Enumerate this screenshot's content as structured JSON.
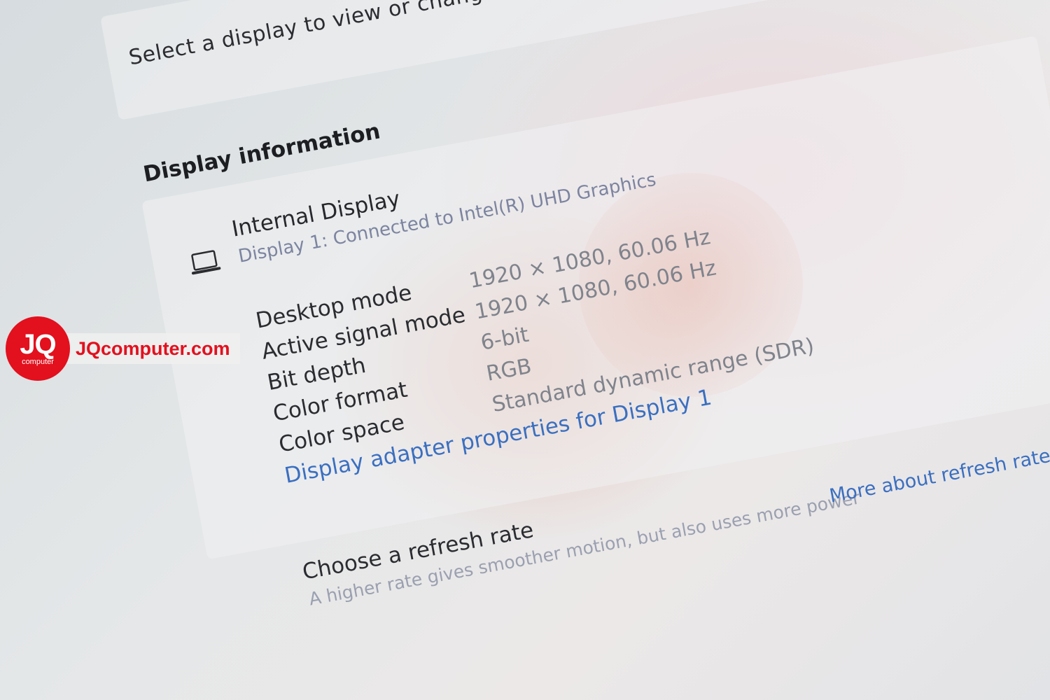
{
  "select_card": {
    "prompt": "Select a display to view or change it"
  },
  "display_information": {
    "title": "Display information",
    "display": {
      "icon": "laptop-icon",
      "name": "Internal Display",
      "subtitle": "Display 1: Connected to Intel(R) UHD Graphics"
    },
    "rows": [
      {
        "label": "Desktop mode",
        "value": "1920 × 1080, 60.06 Hz"
      },
      {
        "label": "Active signal mode",
        "value": "1920 × 1080, 60.06 Hz"
      },
      {
        "label": "Bit depth",
        "value": "6-bit"
      },
      {
        "label": "Color format",
        "value": "RGB"
      },
      {
        "label": "Color space",
        "value": "Standard dynamic range (SDR)"
      }
    ],
    "adapter_link": "Display adapter properties for Display 1"
  },
  "refresh_rate": {
    "title": "Choose a refresh rate",
    "subtitle": "A higher rate gives smoother motion, but also uses more power",
    "link": "More about refresh rate"
  },
  "watermark": {
    "logo_text": "JQ",
    "logo_sub": "computer",
    "site": "JQcomputer.com",
    "color": "#e3101e"
  },
  "colors": {
    "link": "#3a6fc0",
    "label": "#2a2c30",
    "value": "#7f838c"
  }
}
